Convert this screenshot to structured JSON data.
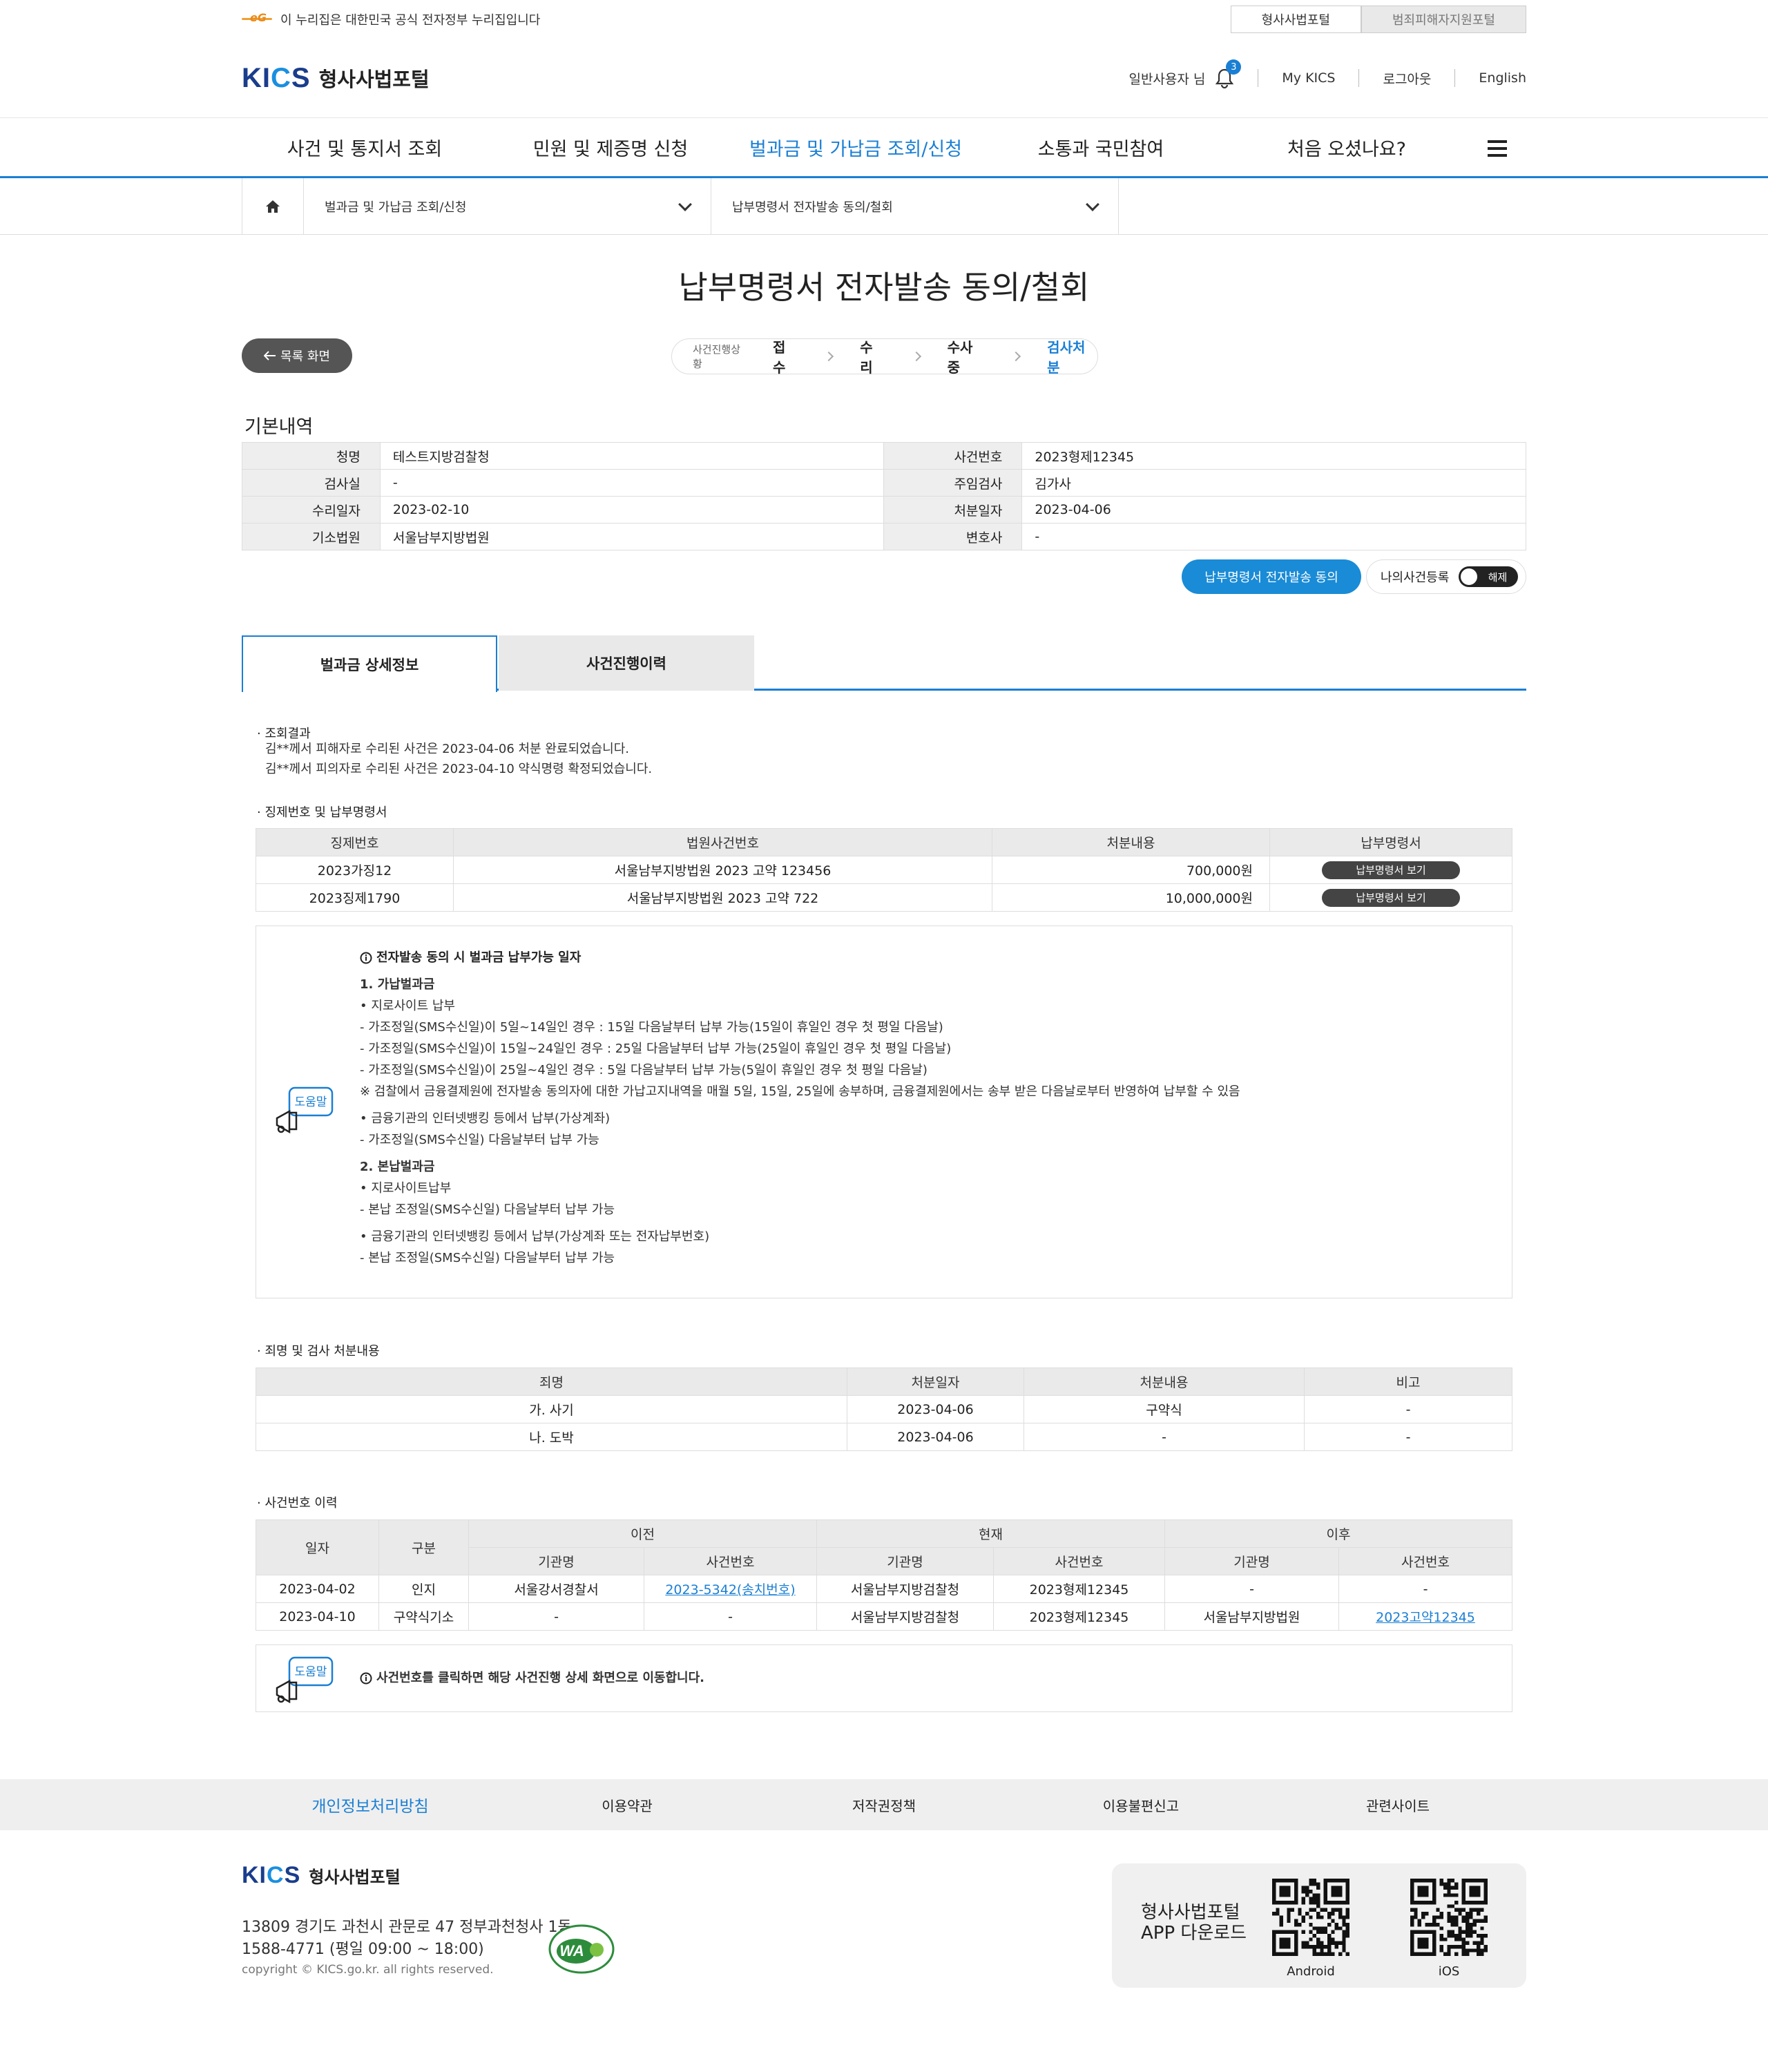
{
  "gov_bar": {
    "logo_text": "eG",
    "notice": "이 누리집은 대한민국 공식 전자정부 누리집입니다",
    "portal_tabs": [
      "형사사법포털",
      "범죄피해자지원포털"
    ]
  },
  "header": {
    "logo_mark": "KICS",
    "logo_text": "형사사법포털",
    "user": "일반사용자 님",
    "notification_count": "3",
    "links": [
      "My KICS",
      "로그아웃",
      "English"
    ]
  },
  "gnb": {
    "items": [
      "사건 및 통지서 조회",
      "민원 및 제증명 신청",
      "벌과금 및 가납금 조회/신청",
      "소통과 국민참여",
      "처음 오셨나요?"
    ],
    "active_index": 2
  },
  "location": {
    "depth1": "벌과금 및 가납금 조회/신청",
    "depth2": "납부명령서 전자발송 동의/철회"
  },
  "page_title": "납부명령서 전자발송 동의/철회",
  "back_button": "목록 화면",
  "progress": {
    "label": "사건진행상황",
    "steps": [
      "접수",
      "수리",
      "수사중",
      "검사처분"
    ],
    "current_index": 3
  },
  "basic": {
    "heading": "기본내역",
    "rows": [
      {
        "l_label": "청명",
        "l_value": "테스트지방검찰청",
        "r_label": "사건번호",
        "r_value": "2023형제12345"
      },
      {
        "l_label": "검사실",
        "l_value": "-",
        "r_label": "주임검사",
        "r_value": "김가사"
      },
      {
        "l_label": "수리일자",
        "l_value": "2023-02-10",
        "r_label": "처분일자",
        "r_value": "2023-04-06"
      },
      {
        "l_label": "기소법원",
        "l_value": "서울남부지방법원",
        "r_label": "변호사",
        "r_value": "-"
      }
    ],
    "consent_button": "납부명령서 전자발송 동의",
    "mycase_label": "나의사건등록",
    "toggle_label": "해제"
  },
  "tabs": [
    "벌과금 상세정보",
    "사건진행이력"
  ],
  "result": {
    "heading": "· 조회결과",
    "lines": [
      "김**께서 피해자로 수리된 사건은 2023-04-06 처분 완료되었습니다.",
      "김**께서 피의자로 수리된 사건은 2023-04-10 약식명령 확정되었습니다."
    ]
  },
  "fine_table": {
    "heading": "· 징제번호 및 납부명령서",
    "headers": [
      "징제번호",
      "법원사건번호",
      "처분내용",
      "납부명령서"
    ],
    "rows": [
      {
        "no": "2023가징12",
        "court": "서울남부지방법원 2023 고약 123456",
        "amount": "700,000원",
        "btn": "납부명령서 보기"
      },
      {
        "no": "2023징제1790",
        "court": "서울남부지방법원 2023 고약 722",
        "amount": "10,000,000원",
        "btn": "납부명령서 보기"
      }
    ]
  },
  "help1": {
    "icon_label": "도움말",
    "title": "전자발송 동의 시 벌과금 납부가능 일자",
    "lines": [
      {
        "text": "1. 가납벌과금",
        "bold": true,
        "gap": 0
      },
      {
        "text": "• 지로사이트 납부",
        "bold": false,
        "gap": 0
      },
      {
        "text": "- 가조정일(SMS수신일)이 5일~14일인 경우 : 15일 다음날부터 납부 가능(15일이 휴일인 경우 첫 평일 다음날)",
        "bold": false,
        "gap": 0
      },
      {
        "text": "- 가조정일(SMS수신일)이 15일~24일인 경우 : 25일 다음날부터 납부 가능(25일이 휴일인 경우 첫 평일 다음날)",
        "bold": false,
        "gap": 0
      },
      {
        "text": "- 가조정일(SMS수신일)이 25일~4일인 경우 : 5일 다음날부터 납부 가능(5일이 휴일인 경우 첫 평일 다음날)",
        "bold": false,
        "gap": 0
      },
      {
        "text": "※ 검찰에서 금융결제원에 전자발송 동의자에 대한 가납고지내역을 매월 5일, 15일, 25일에 송부하며, 금융결제원에서는 송부 받은 다음날로부터 반영하여 납부할 수 있음",
        "bold": false,
        "gap": 0
      },
      {
        "text": "• 금융기관의 인터넷뱅킹 등에서 납부(가상계좌)",
        "bold": false,
        "gap": 1
      },
      {
        "text": "- 가조정일(SMS수신일) 다음날부터 납부 가능",
        "bold": false,
        "gap": 0
      },
      {
        "text": "2. 본납벌과금",
        "bold": true,
        "gap": 1
      },
      {
        "text": "• 지로사이트납부",
        "bold": false,
        "gap": 0
      },
      {
        "text": "- 본납 조정일(SMS수신일) 다음날부터 납부 가능",
        "bold": false,
        "gap": 0
      },
      {
        "text": "• 금융기관의 인터넷뱅킹 등에서 납부(가상계좌 또는 전자납부번호)",
        "bold": false,
        "gap": 1
      },
      {
        "text": "- 본납 조정일(SMS수신일) 다음날부터 납부 가능",
        "bold": false,
        "gap": 0
      }
    ]
  },
  "crime_table": {
    "heading": "· 죄명 및 검사 처분내용",
    "headers": [
      "죄명",
      "처분일자",
      "처분내용",
      "비고"
    ],
    "rows": [
      {
        "name": "가. 사기",
        "date": "2023-04-06",
        "result": "구약식",
        "note": "-"
      },
      {
        "name": "나. 도박",
        "date": "2023-04-06",
        "result": "-",
        "note": "-"
      }
    ]
  },
  "history_table": {
    "heading": "· 사건번호 이력",
    "headers": {
      "date": "일자",
      "type": "구분",
      "prev": "이전",
      "curr": "현재",
      "next": "이후",
      "org": "기관명",
      "caseno": "사건번호"
    },
    "rows": [
      {
        "date": "2023-04-02",
        "type": "인지",
        "prev_org": "서울강서경찰서",
        "prev_no": "2023-5342(송치번호)",
        "curr_org": "서울남부지방검찰청",
        "curr_no": "2023형제12345",
        "next_org": "-",
        "next_no": "-"
      },
      {
        "date": "2023-04-10",
        "type": "구약식기소",
        "prev_org": "-",
        "prev_no": "-",
        "curr_org": "서울남부지방검찰청",
        "curr_no": "2023형제12345",
        "next_org": "서울남부지방법원",
        "next_no": "2023고약12345"
      }
    ]
  },
  "help2": {
    "icon_label": "도움말",
    "text": "사건번호를 클릭하면 해당 사건진행 상세 화면으로 이동합니다."
  },
  "footer": {
    "nav": [
      "개인정보처리방침",
      "이용약관",
      "저작권정책",
      "이용불편신고",
      "관련사이트"
    ],
    "logo_mark": "KICS",
    "logo_text": "형사사법포털",
    "address": "13809  경기도 과천시 관문로 47 정부과천청사 1동",
    "phone": "1588-4771 (평일 09:00 ~ 18:00)",
    "copyright": "copyright © KICS.go.kr. all rights reserved.",
    "wa_mark": "WA",
    "app_title_1": "형사사법포털",
    "app_title_2": "APP 다운로드",
    "android": "Android",
    "ios": "iOS"
  },
  "colors": {
    "accent": "#1a7fd4",
    "dark_button": "#555555",
    "table_head": "#eaeaea"
  },
  "icons": [
    "bell-icon",
    "home-icon",
    "chevron-down-icon",
    "menu-icon",
    "arrow-left-icon",
    "info-icon",
    "megaphone-icon",
    "qr-code-icon"
  ]
}
